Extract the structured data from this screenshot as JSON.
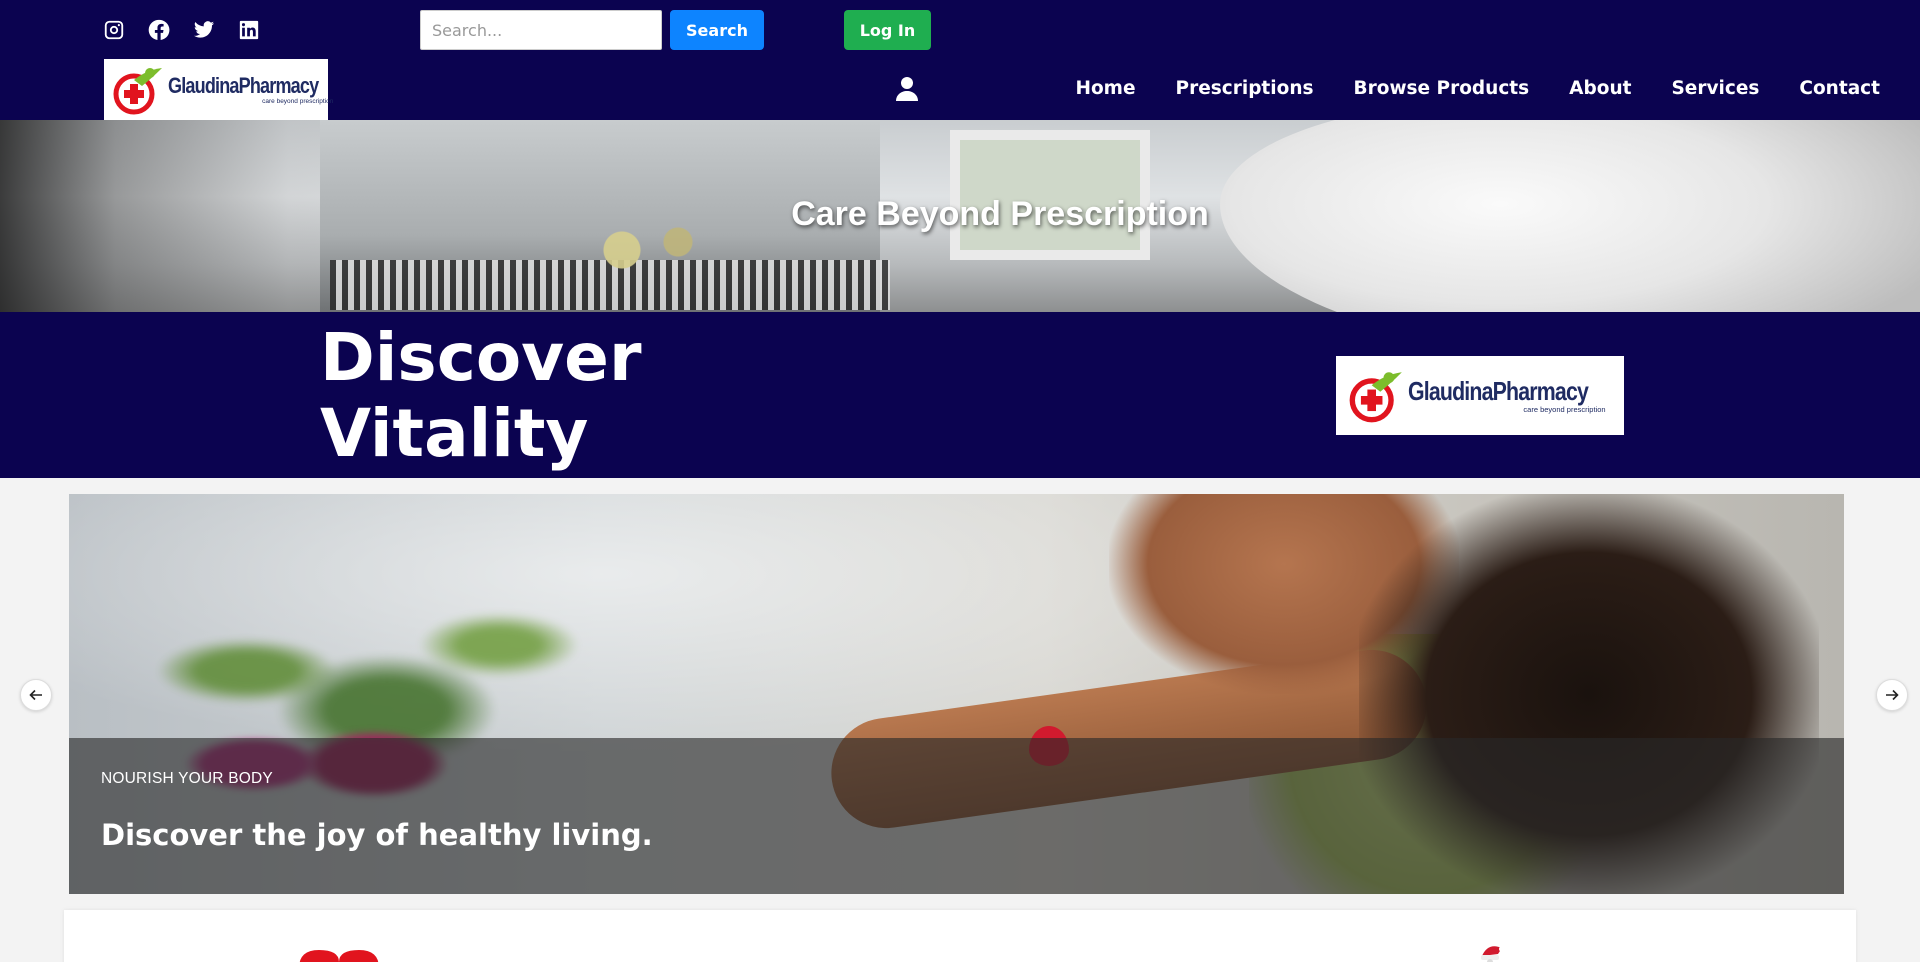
{
  "header": {
    "social": [
      {
        "name": "instagram-icon"
      },
      {
        "name": "facebook-icon"
      },
      {
        "name": "twitter-icon"
      },
      {
        "name": "linkedin-icon"
      }
    ],
    "search": {
      "placeholder": "Search...",
      "value": "",
      "button_label": "Search"
    },
    "login_label": "Log In",
    "logo": {
      "name": "GlaudinaPharmacy",
      "tagline": "care beyond prescription"
    },
    "nav": [
      "Home",
      "Prescriptions",
      "Browse Products",
      "About",
      "Services",
      "Contact"
    ],
    "colors": {
      "header_bg": "#0b0350",
      "search_btn": "#0d84ff",
      "login_btn": "#1fae50"
    }
  },
  "hero": {
    "title": "Care Beyond Prescription"
  },
  "band": {
    "title_line1": "Discover",
    "title_line2": "Vitality",
    "logo": {
      "name": "GlaudinaPharmacy",
      "tagline": "care beyond prescription"
    }
  },
  "carousel": {
    "eyebrow": "NOURISH YOUR BODY",
    "title": "Discover the joy of healthy living.",
    "prev_icon": "arrow-left-icon",
    "next_icon": "arrow-right-icon"
  },
  "card": {
    "icons": [
      "heart-icon",
      "santa-icon"
    ]
  }
}
